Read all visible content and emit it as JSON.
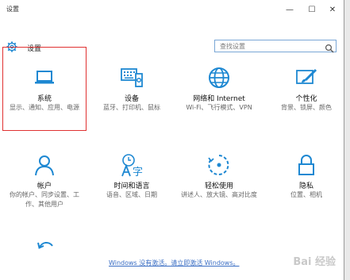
{
  "window": {
    "title": "设置",
    "controls": {
      "minimize": "—",
      "maximize": "☐",
      "close": "✕"
    }
  },
  "header": {
    "label": "设置",
    "search": {
      "placeholder": "查找设置"
    }
  },
  "tiles": [
    {
      "name": "系统",
      "desc": "显示、通知、应用、电源",
      "icon": "laptop-icon"
    },
    {
      "name": "设备",
      "desc": "蓝牙、打印机、鼠标",
      "icon": "keyboard-icon"
    },
    {
      "name": "网络和 Internet",
      "desc": "Wi-Fi、飞行模式、VPN",
      "icon": "globe-icon"
    },
    {
      "name": "个性化",
      "desc": "背景、锁屏、颜色",
      "icon": "brush-icon"
    },
    {
      "name": "帐户",
      "desc": "你的帐户、同步设置、工作、其他用户",
      "icon": "person-icon"
    },
    {
      "name": "时间和语言",
      "desc": "语音、区域、日期",
      "icon": "time-language-icon"
    },
    {
      "name": "轻松使用",
      "desc": "讲述人、放大镜、高对比度",
      "icon": "ease-of-access-icon"
    },
    {
      "name": "隐私",
      "desc": "位置、相机",
      "icon": "lock-icon"
    },
    {
      "name": "",
      "desc": "",
      "icon": "update-icon"
    }
  ],
  "activation_text": "Windows 没有激活。请立即激活 Windows。",
  "watermark": "Bai 经验",
  "colors": {
    "accent": "#1e88d2",
    "selection": "#e03131",
    "link": "#3a6ec4"
  }
}
